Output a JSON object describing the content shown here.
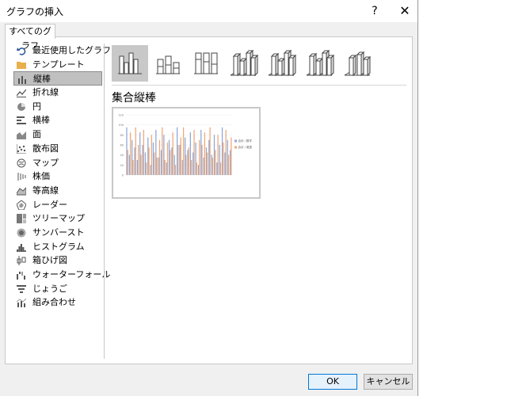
{
  "window": {
    "title": "グラフの挿入",
    "help": "?",
    "close": "✕"
  },
  "tab": {
    "label": "すべてのグラフ"
  },
  "sidebar": {
    "items": [
      {
        "label": "最近使用したグラフ",
        "icon": "undo-arrow-icon"
      },
      {
        "label": "テンプレート",
        "icon": "folder-icon"
      },
      {
        "label": "縦棒",
        "icon": "column-chart-icon"
      },
      {
        "label": "折れ線",
        "icon": "line-chart-icon"
      },
      {
        "label": "円",
        "icon": "pie-chart-icon"
      },
      {
        "label": "横棒",
        "icon": "bar-chart-icon"
      },
      {
        "label": "面",
        "icon": "area-chart-icon"
      },
      {
        "label": "散布図",
        "icon": "scatter-chart-icon"
      },
      {
        "label": "マップ",
        "icon": "map-chart-icon"
      },
      {
        "label": "株価",
        "icon": "stock-chart-icon"
      },
      {
        "label": "等高線",
        "icon": "surface-chart-icon"
      },
      {
        "label": "レーダー",
        "icon": "radar-chart-icon"
      },
      {
        "label": "ツリーマップ",
        "icon": "treemap-chart-icon"
      },
      {
        "label": "サンバースト",
        "icon": "sunburst-chart-icon"
      },
      {
        "label": "ヒストグラム",
        "icon": "histogram-chart-icon"
      },
      {
        "label": "箱ひげ図",
        "icon": "box-whisker-chart-icon"
      },
      {
        "label": "ウォーターフォール",
        "icon": "waterfall-chart-icon"
      },
      {
        "label": "じょうご",
        "icon": "funnel-chart-icon"
      },
      {
        "label": "組み合わせ",
        "icon": "combo-chart-icon"
      }
    ],
    "selected_index": 2
  },
  "chart_types": {
    "selected_index": 0
  },
  "main": {
    "subtitle": "集合縦棒"
  },
  "chart_data": {
    "type": "bar",
    "categories": [
      "",
      "",
      "",
      "",
      "",
      "",
      "",
      "",
      "",
      "",
      "",
      "",
      "",
      "",
      "",
      "",
      "",
      "",
      "",
      "",
      "",
      "",
      "",
      "",
      "",
      "",
      "",
      "",
      "",
      "",
      "",
      "",
      "",
      "",
      "",
      "",
      "",
      "",
      "",
      ""
    ],
    "series": [
      {
        "name": "合計 / 数学",
        "color": "#8fa8d8",
        "values": [
          95,
          40,
          70,
          55,
          30,
          85,
          60,
          45,
          75,
          20,
          65,
          90,
          35,
          50,
          80,
          25,
          70,
          55,
          40,
          95,
          60,
          30,
          75,
          50,
          85,
          45,
          65,
          20,
          90,
          35,
          55,
          70,
          40,
          80,
          25,
          60,
          95,
          45,
          70,
          50
        ]
      },
      {
        "name": "合計 / 英語",
        "color": "#f0a878",
        "values": [
          50,
          85,
          30,
          95,
          60,
          40,
          90,
          25,
          55,
          80,
          45,
          35,
          70,
          95,
          30,
          65,
          50,
          85,
          20,
          60,
          75,
          95,
          40,
          55,
          30,
          90,
          25,
          70,
          60,
          85,
          45,
          95,
          35,
          50,
          80,
          25,
          65,
          90,
          40,
          75
        ]
      }
    ],
    "ylim": [
      0,
      120
    ],
    "yticks": [
      "120",
      "100",
      "80",
      "60",
      "40",
      "20",
      "0"
    ],
    "legend": "right"
  },
  "buttons": {
    "ok": "OK",
    "cancel": "キャンセル"
  }
}
